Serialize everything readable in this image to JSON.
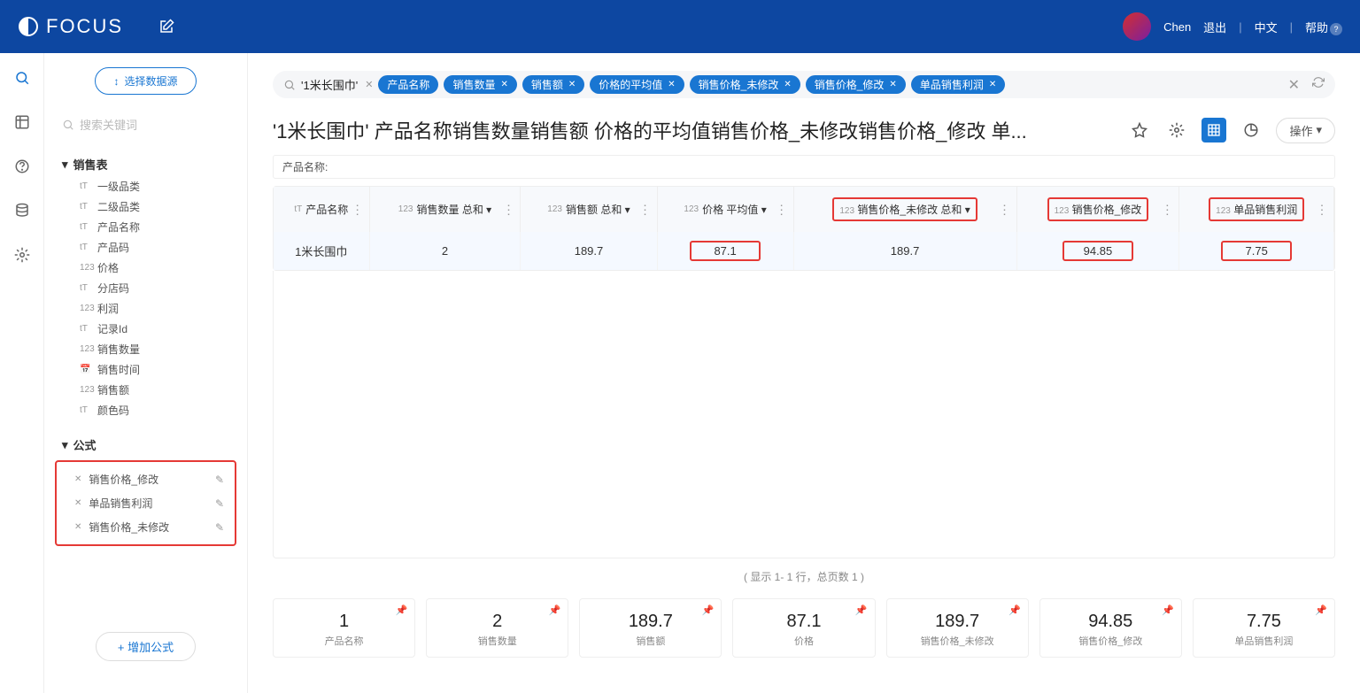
{
  "topbar": {
    "brand": "FOCUS",
    "user": "Chen",
    "logout": "退出",
    "lang": "中文",
    "help": "帮助"
  },
  "sidebar": {
    "select_source": "选择数据源",
    "search_placeholder": "搜索关键词",
    "sales_table": "销售表",
    "fields": [
      "一级品类",
      "二级品类",
      "产品名称",
      "产品码",
      "价格",
      "分店码",
      "利润",
      "记录Id",
      "销售数量",
      "销售时间",
      "销售额",
      "颜色码"
    ],
    "formula": "公式",
    "formula_items": [
      "销售价格_修改",
      "单品销售利润",
      "销售价格_未修改"
    ],
    "add_formula": "+ 增加公式"
  },
  "query": {
    "text": "'1米长围巾'",
    "chips": [
      "产品名称",
      "销售数量",
      "销售额",
      "价格的平均值",
      "销售价格_未修改",
      "销售价格_修改",
      "单品销售利润"
    ]
  },
  "title": "'1米长围巾' 产品名称销售数量销售额 价格的平均值销售价格_未修改销售价格_修改 单...",
  "ops": "操作",
  "product_name_label": "产品名称:",
  "table": {
    "headers": [
      "产品名称",
      "销售数量 总和",
      "销售额 总和",
      "价格 平均值",
      "销售价格_未修改 总和",
      "销售价格_修改",
      "单品销售利润"
    ],
    "row": [
      "1米长围巾",
      "2",
      "189.7",
      "87.1",
      "189.7",
      "94.85",
      "7.75"
    ]
  },
  "pager": "( 显示 1- 1 行，总页数 1 )",
  "cards": [
    {
      "val": "1",
      "lbl": "产品名称"
    },
    {
      "val": "2",
      "lbl": "销售数量"
    },
    {
      "val": "189.7",
      "lbl": "销售额"
    },
    {
      "val": "87.1",
      "lbl": "价格"
    },
    {
      "val": "189.7",
      "lbl": "销售价格_未修改"
    },
    {
      "val": "94.85",
      "lbl": "销售价格_修改"
    },
    {
      "val": "7.75",
      "lbl": "单品销售利润"
    }
  ]
}
